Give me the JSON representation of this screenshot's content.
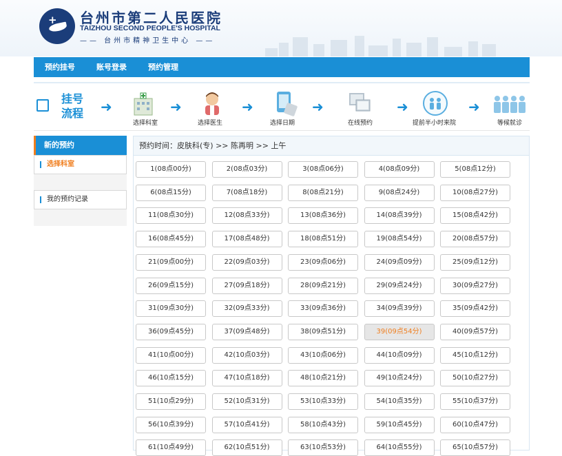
{
  "hospital": {
    "name_cn": "台州市第二人民医院",
    "name_en": "TAIZHOU SECOND PEOPLE'S HOSPITAL",
    "subtitle": "—— 台州市精神卫生中心 ——"
  },
  "nav": {
    "items": [
      "预约挂号",
      "账号登录",
      "预约管理"
    ]
  },
  "flow": {
    "title": "挂号流程",
    "steps": [
      "选择科室",
      "选择医生",
      "选择日期",
      "在线预约",
      "提前半小时来院",
      "等候就诊"
    ]
  },
  "sidebar": {
    "header": "新的预约",
    "items": [
      "选择科室",
      "我的预约记录"
    ]
  },
  "breadcrumb": "预约时间：皮肤科(专) >> 陈再明 >> 上午",
  "colors": {
    "primary": "#1a8fd6",
    "accent": "#f07e1e",
    "brand": "#1b3d7a"
  },
  "slots": [
    {
      "label": "1(08点00分)"
    },
    {
      "label": "2(08点03分)"
    },
    {
      "label": "3(08点06分)"
    },
    {
      "label": "4(08点09分)"
    },
    {
      "label": "5(08点12分)"
    },
    {
      "label": "6(08点15分)"
    },
    {
      "label": "7(08点18分)"
    },
    {
      "label": "8(08点21分)"
    },
    {
      "label": "9(08点24分)"
    },
    {
      "label": "10(08点27分)"
    },
    {
      "label": "11(08点30分)"
    },
    {
      "label": "12(08点33分)"
    },
    {
      "label": "13(08点36分)"
    },
    {
      "label": "14(08点39分)"
    },
    {
      "label": "15(08点42分)"
    },
    {
      "label": "16(08点45分)"
    },
    {
      "label": "17(08点48分)"
    },
    {
      "label": "18(08点51分)"
    },
    {
      "label": "19(08点54分)"
    },
    {
      "label": "20(08点57分)"
    },
    {
      "label": "21(09点00分)"
    },
    {
      "label": "22(09点03分)"
    },
    {
      "label": "23(09点06分)"
    },
    {
      "label": "24(09点09分)"
    },
    {
      "label": "25(09点12分)"
    },
    {
      "label": "26(09点15分)"
    },
    {
      "label": "27(09点18分)"
    },
    {
      "label": "28(09点21分)"
    },
    {
      "label": "29(09点24分)"
    },
    {
      "label": "30(09点27分)"
    },
    {
      "label": "31(09点30分)"
    },
    {
      "label": "32(09点33分)"
    },
    {
      "label": "33(09点36分)"
    },
    {
      "label": "34(09点39分)"
    },
    {
      "label": "35(09点42分)"
    },
    {
      "label": "36(09点45分)"
    },
    {
      "label": "37(09点48分)"
    },
    {
      "label": "38(09点51分)"
    },
    {
      "label": "39(09点54分)",
      "selected": true
    },
    {
      "label": "40(09点57分)"
    },
    {
      "label": "41(10点00分)"
    },
    {
      "label": "42(10点03分)"
    },
    {
      "label": "43(10点06分)"
    },
    {
      "label": "44(10点09分)"
    },
    {
      "label": "45(10点12分)"
    },
    {
      "label": "46(10点15分)"
    },
    {
      "label": "47(10点18分)"
    },
    {
      "label": "48(10点21分)"
    },
    {
      "label": "49(10点24分)"
    },
    {
      "label": "50(10点27分)"
    },
    {
      "label": "51(10点29分)"
    },
    {
      "label": "52(10点31分)"
    },
    {
      "label": "53(10点33分)"
    },
    {
      "label": "54(10点35分)"
    },
    {
      "label": "55(10点37分)"
    },
    {
      "label": "56(10点39分)"
    },
    {
      "label": "57(10点41分)"
    },
    {
      "label": "58(10点43分)"
    },
    {
      "label": "59(10点45分)"
    },
    {
      "label": "60(10点47分)"
    },
    {
      "label": "61(10点49分)"
    },
    {
      "label": "62(10点51分)"
    },
    {
      "label": "63(10点53分)"
    },
    {
      "label": "64(10点55分)"
    },
    {
      "label": "65(10点57分)"
    }
  ]
}
